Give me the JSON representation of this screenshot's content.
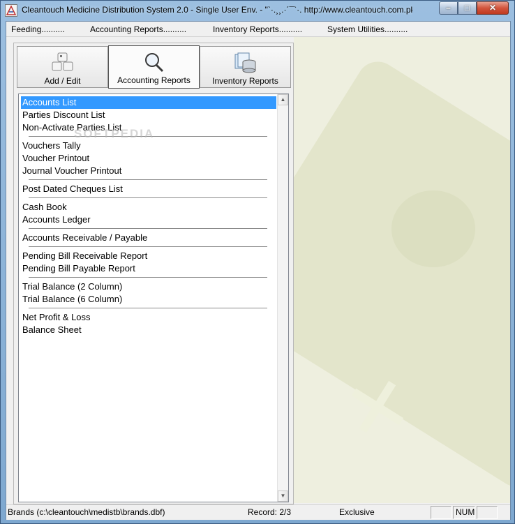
{
  "window": {
    "title": "Cleantouch Medicine Distribution System 2.0 - Single User Env.  -  \"`·.¸¸.·´¯`·. http://www.cleantouch.com.pk ¸¸.·´¯`",
    "minimize_glyph": "–",
    "maximize_glyph": "□",
    "close_glyph": "✕"
  },
  "menu": [
    "Feeding..........",
    "Accounting Reports..........",
    "Inventory Reports..........",
    "System Utilities.........."
  ],
  "tabs": [
    {
      "label": "Add / Edit",
      "icon": "keyboard-keys-icon"
    },
    {
      "label": "Accounting Reports",
      "icon": "magnifier-icon",
      "active": true
    },
    {
      "label": "Inventory Reports",
      "icon": "database-documents-icon"
    }
  ],
  "list_items": {
    "g1": [
      "Accounts List",
      "Parties Discount List",
      "Non-Activate Parties List"
    ],
    "g2": [
      "Vouchers Tally",
      "Voucher Printout",
      "Journal Voucher Printout"
    ],
    "g3": [
      "Post Dated Cheques List"
    ],
    "g4": [
      "Cash Book",
      "Accounts Ledger"
    ],
    "g5": [
      "Accounts Receivable / Payable"
    ],
    "g6": [
      "Pending Bill Receivable Report",
      "Pending Bill Payable Report"
    ],
    "g7": [
      "Trial Balance (2 Column)",
      "Trial Balance (6 Column)"
    ],
    "g8": [
      "Net Profit & Loss",
      "Balance Sheet"
    ]
  },
  "selected_item": "Accounts List",
  "watermark": "SOFTPEDIA",
  "status": {
    "file": "Brands (c:\\cleantouch\\medistb\\brands.dbf)",
    "record": "Record: 2/3",
    "mode": "Exclusive",
    "box1": "",
    "num": "NUM",
    "box3": ""
  },
  "colors": {
    "selection": "#3399ff",
    "titlebar": "#9cbfe0",
    "background_watermark": "#eeefdf"
  }
}
